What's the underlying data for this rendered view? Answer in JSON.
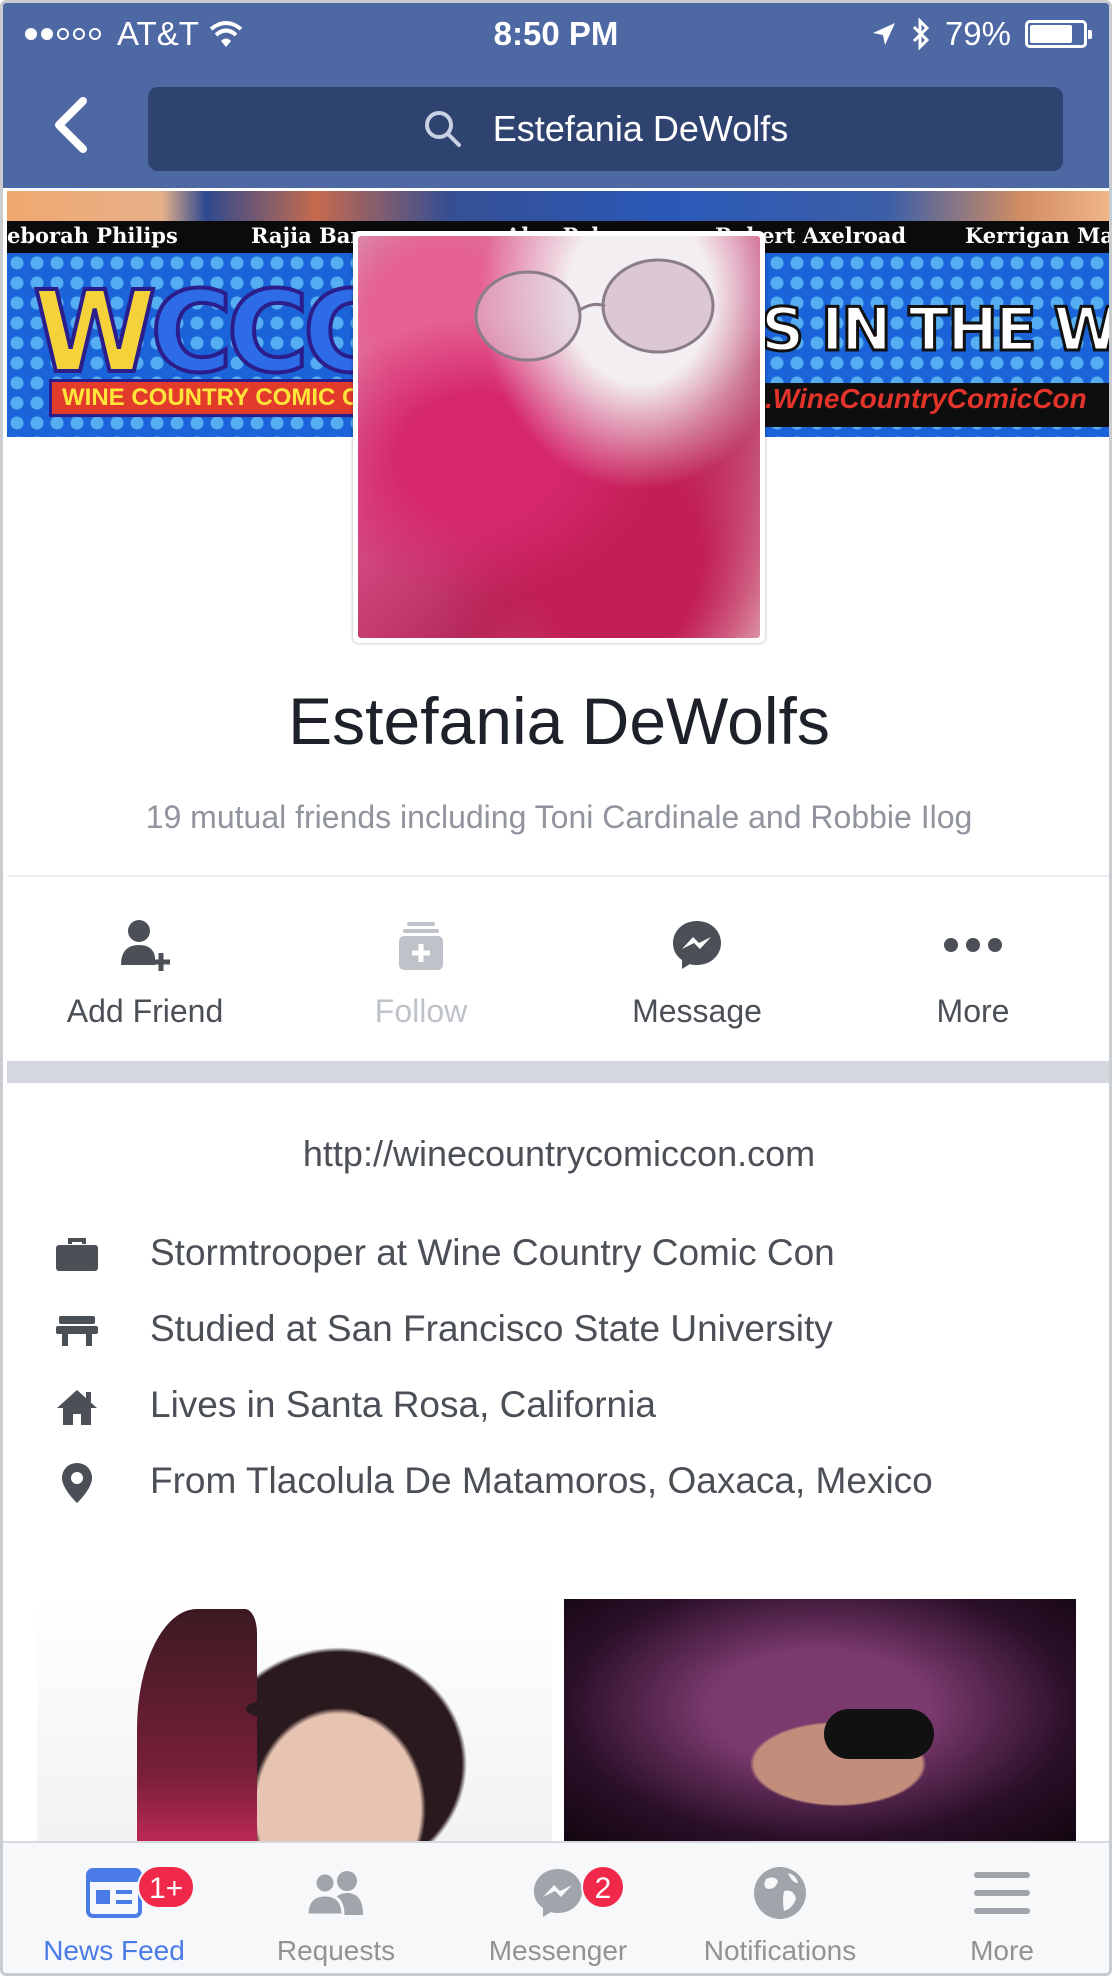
{
  "status_bar": {
    "carrier": "AT&T",
    "time": "8:50 PM",
    "battery": "79%",
    "battery_level": 0.79,
    "signal_bars_filled": 2,
    "signal_bars_total": 5
  },
  "nav": {
    "search_text": "Estefania DeWolfs"
  },
  "cover": {
    "guest_names": [
      "eborah Philips",
      "Rajia Bar",
      "Alex Pal",
      "Robert Axelroad",
      "Kerrigan Mal"
    ],
    "logo_letters": "WCCC",
    "logo_subtitle": "WINE COUNTRY COMIC CON",
    "banner_text": "S IN THE WINE",
    "banner_url": ".WineCountryComicCon"
  },
  "profile": {
    "name": "Estefania DeWolfs",
    "mutual": "19 mutual friends including Toni Cardinale and Robbie Ilog"
  },
  "actions": [
    {
      "label": "Add Friend",
      "icon": "add-friend-icon",
      "enabled": true
    },
    {
      "label": "Follow",
      "icon": "follow-icon",
      "enabled": false
    },
    {
      "label": "Message",
      "icon": "messenger-icon",
      "enabled": true
    },
    {
      "label": "More",
      "icon": "more-dots-icon",
      "enabled": true
    }
  ],
  "intro": {
    "website": "http://winecountrycomiccon.com",
    "items": [
      {
        "icon": "briefcase-icon",
        "text": "Stormtrooper at Wine Country Comic Con"
      },
      {
        "icon": "school-icon",
        "text": "Studied at San Francisco State University"
      },
      {
        "icon": "home-icon",
        "text": "Lives in Santa Rosa, California"
      },
      {
        "icon": "location-pin-icon",
        "text": "From Tlacolula De Matamoros, Oaxaca, Mexico"
      }
    ]
  },
  "tabbar": [
    {
      "label": "News Feed",
      "icon": "news-feed-icon",
      "active": true,
      "badge": "1+"
    },
    {
      "label": "Requests",
      "icon": "requests-icon",
      "active": false,
      "badge": ""
    },
    {
      "label": "Messenger",
      "icon": "messenger-icon",
      "active": false,
      "badge": "2"
    },
    {
      "label": "Notifications",
      "icon": "globe-icon",
      "active": false,
      "badge": ""
    },
    {
      "label": "More",
      "icon": "menu-icon",
      "active": false,
      "badge": ""
    }
  ],
  "colors": {
    "nav_blue": "#4e68a3",
    "search_bg": "#2f4370",
    "active_tab": "#4a7be6",
    "badge_red": "#f02849"
  }
}
